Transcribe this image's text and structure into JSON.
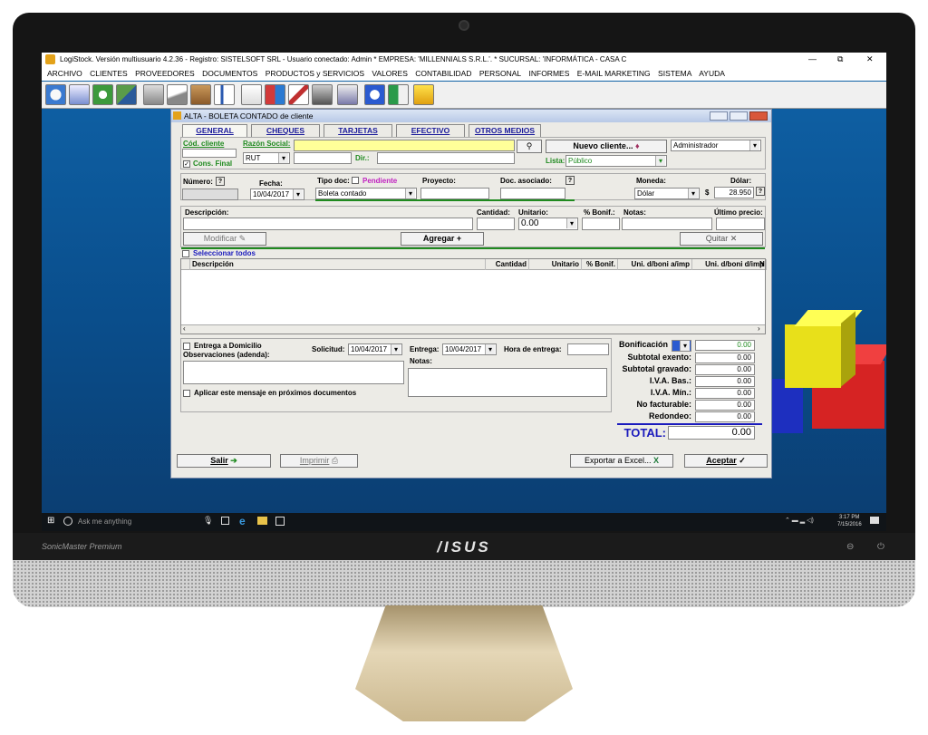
{
  "window": {
    "title": "LogiStock. Versión multiusuario 4.2.36 - Registro: SISTELSOFT SRL - Usuario conectado: Admin * EMPRESA: 'MILLENNIALS S.R.L.'. * SUCURSAL: 'INFORMÁTICA - CASA C",
    "controls": [
      "—",
      "⧉",
      "✕"
    ]
  },
  "menu": [
    "ARCHIVO",
    "CLIENTES",
    "PROVEEDORES",
    "DOCUMENTOS",
    "PRODUCTOS y SERVICIOS",
    "VALORES",
    "CONTABILIDAD",
    "PERSONAL",
    "INFORMES",
    "E-MAIL MARKETING",
    "SISTEMA",
    "AYUDA"
  ],
  "toolbar": [
    "toolbar-clock-icon",
    "toolbar-document-icon",
    "toolbar-recycle-icon",
    "toolbar-users-icon",
    "toolbar-calculator-icon",
    "toolbar-book-icon",
    "toolbar-box-icon",
    "toolbar-chart-icon",
    "toolbar-note-icon",
    "toolbar-pills-icon",
    "toolbar-pen-icon",
    "toolbar-tools-icon",
    "toolbar-help-book-icon",
    "toolbar-question-icon",
    "toolbar-exit-icon",
    "toolbar-warning-icon"
  ],
  "dialog": {
    "title": "ALTA - BOLETA CONTADO de cliente",
    "tabs": [
      "GENERAL",
      "CHEQUES",
      "TARJETAS",
      "EFECTIVO",
      "OTROS MEDIOS"
    ],
    "cod_cliente_label": "Cód. cliente",
    "razon_social_label": "Razón Social:",
    "cons_final_label": "Cons. Final",
    "rut_value": "RUT",
    "dir_label": "Dir.:",
    "nuevo_cliente_label": "Nuevo cliente...",
    "lista_label": "Lista:",
    "lista_value": "Público",
    "user_value": "Administrador",
    "numero_label": "Número:",
    "fecha_label": "Fecha:",
    "fecha_value": "10/04/2017",
    "tipo_doc_label": "Tipo doc:",
    "pendiente_label": "Pendiente",
    "tipo_doc_value": "Boleta contado",
    "proyecto_label": "Proyecto:",
    "doc_asociado_label": "Doc. asociado:",
    "moneda_label": "Moneda:",
    "moneda_value": "Dólar",
    "dolar_label": "Dólar:",
    "dolar_symbol": "$",
    "dolar_value": "28.950",
    "descripcion_label": "Descripción:",
    "cantidad_label": "Cantidad:",
    "unitario_label": "Unitario:",
    "unitario_value": "0.00",
    "bonif_label": "% Bonif.:",
    "notas_label": "Notas:",
    "ultimo_precio_label": "Último precio:",
    "modificar_label": "Modificar",
    "agregar_label": "Agregar",
    "quitar_label": "Quitar",
    "seleccionar_todos_label": "Seleccionar todos",
    "table_headers": [
      "Descripción",
      "Cantidad",
      "Unitario",
      "% Bonif.",
      "Uni. d/boni a/imp",
      "Uni. d/boni d/imp",
      "N"
    ],
    "entrega_domicilio_label": "Entrega a Domicilio",
    "solicitud_label": "Solicitud:",
    "solicitud_value": "10/04/2017",
    "entrega_label": "Entrega:",
    "entrega_value": "10/04/2017",
    "hora_entrega_label": "Hora de entrega:",
    "observaciones_label": "Observaciones (adenda):",
    "notas2_label": "Notas:",
    "aplicar_label": "Aplicar este mensaje en próximos documentos",
    "totals": [
      {
        "label": "Subtotal exento:",
        "value": "0.00"
      },
      {
        "label": "Subtotal gravado:",
        "value": "0.00"
      },
      {
        "label": "I.V.A. Bas.:",
        "value": "0.00"
      },
      {
        "label": "I.V.A. Mín.:",
        "value": "0.00"
      },
      {
        "label": "No facturable:",
        "value": "0.00"
      },
      {
        "label": "Redondeo:",
        "value": "0.00"
      }
    ],
    "bonificacion_label": "Bonificación",
    "bonificacion_value": "0.00",
    "total_label": "TOTAL:",
    "total_value": "0.00",
    "salir_label": "Salir",
    "imprimir_label": "Imprimir",
    "exportar_label": "Exportar a Excel...",
    "aceptar_label": "Aceptar"
  },
  "taskbar": {
    "search_placeholder": "Ask me anything",
    "time": "3:17 PM",
    "date": "7/15/2016"
  },
  "device": {
    "brand": "/ISUS",
    "speaker_label": "SonicMaster Premium"
  },
  "colors": {
    "accent_blue": "#1b1bbd",
    "accent_green": "#1f8a1f",
    "razon_social_bg": "#ffff99",
    "desktop_blue": "#0a4e8c"
  }
}
